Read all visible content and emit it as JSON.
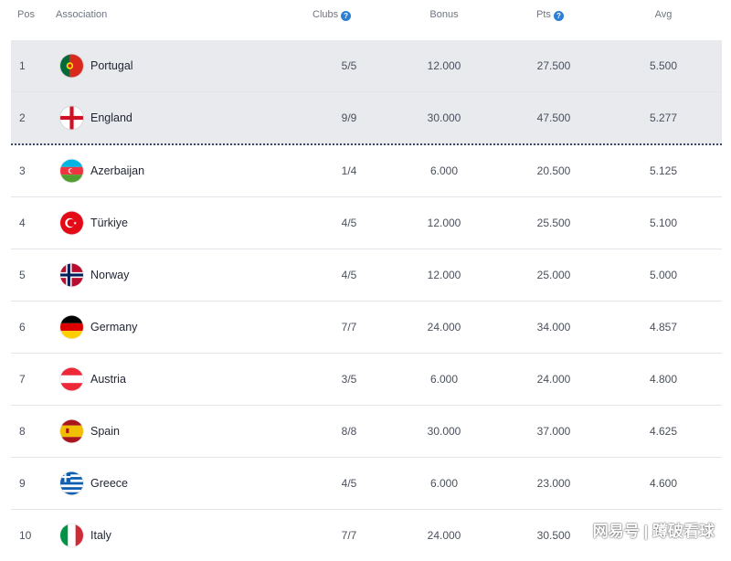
{
  "table": {
    "columns": {
      "pos": "Pos",
      "association": "Association",
      "clubs": "Clubs",
      "bonus": "Bonus",
      "pts": "Pts",
      "avg": "Avg"
    },
    "rows": [
      {
        "pos": "1",
        "name": "Portugal",
        "flag": "portugal-flag-icon",
        "clubs": "5/5",
        "bonus": "12.000",
        "pts": "27.500",
        "avg": "5.500"
      },
      {
        "pos": "2",
        "name": "England",
        "flag": "england-flag-icon",
        "clubs": "9/9",
        "bonus": "30.000",
        "pts": "47.500",
        "avg": "5.277"
      },
      {
        "pos": "3",
        "name": "Azerbaijan",
        "flag": "azerbaijan-flag-icon",
        "clubs": "1/4",
        "bonus": "6.000",
        "pts": "20.500",
        "avg": "5.125"
      },
      {
        "pos": "4",
        "name": "Türkiye",
        "flag": "turkiye-flag-icon",
        "clubs": "4/5",
        "bonus": "12.000",
        "pts": "25.500",
        "avg": "5.100"
      },
      {
        "pos": "5",
        "name": "Norway",
        "flag": "norway-flag-icon",
        "clubs": "4/5",
        "bonus": "12.000",
        "pts": "25.000",
        "avg": "5.000"
      },
      {
        "pos": "6",
        "name": "Germany",
        "flag": "germany-flag-icon",
        "clubs": "7/7",
        "bonus": "24.000",
        "pts": "34.000",
        "avg": "4.857"
      },
      {
        "pos": "7",
        "name": "Austria",
        "flag": "austria-flag-icon",
        "clubs": "3/5",
        "bonus": "6.000",
        "pts": "24.000",
        "avg": "4.800"
      },
      {
        "pos": "8",
        "name": "Spain",
        "flag": "spain-flag-icon",
        "clubs": "8/8",
        "bonus": "30.000",
        "pts": "37.000",
        "avg": "4.625"
      },
      {
        "pos": "9",
        "name": "Greece",
        "flag": "greece-flag-icon",
        "clubs": "4/5",
        "bonus": "6.000",
        "pts": "23.000",
        "avg": "4.600"
      },
      {
        "pos": "10",
        "name": "Italy",
        "flag": "italy-flag-icon",
        "clubs": "7/7",
        "bonus": "24.000",
        "pts": "30.500",
        "avg": ""
      }
    ]
  },
  "watermark": "网易号 | 蹲破看球",
  "colors": {
    "highlight_row": "#e8eaee",
    "info_icon": "#2d7fd3",
    "cutoff_line": "#3a4a66"
  }
}
